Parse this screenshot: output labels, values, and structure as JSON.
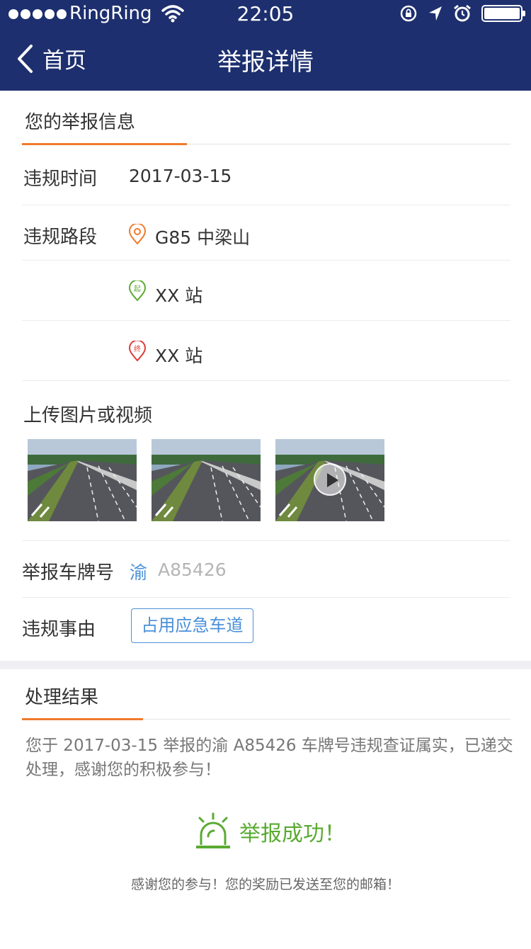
{
  "status_bar": {
    "carrier": "RingRing",
    "time": "22:05"
  },
  "nav": {
    "back_label": "首页",
    "title": "举报详情"
  },
  "report_info": {
    "section_title": "您的举报信息",
    "violation_time_label": "违规时间",
    "violation_time": "2017-03-15",
    "violation_road_label": "违规路段",
    "road": "G85 中梁山",
    "start_station": "XX 站",
    "end_station": "XX 站",
    "start_badge": "起",
    "end_badge": "终",
    "media_label": "上传图片或视频",
    "media_items": [
      "image",
      "image",
      "video"
    ],
    "plate_label": "举报车牌号",
    "plate_province": "渝",
    "plate_number": "A85426",
    "reason_label": "违规事由",
    "reason_tag": "占用应急车道"
  },
  "result": {
    "section_title": "处理结果",
    "message": "您于 2017-03-15 举报的渝 A85426 车牌号违规查证属实，已递交处理，感谢您的积极参与！",
    "success_title": "举报成功！",
    "thanks_note": "感谢您的参与！您的奖励已发送至您的邮箱！"
  },
  "colors": {
    "nav_bg": "#1d2f6e",
    "accent_orange": "#f07a2c",
    "link_blue": "#4a90d9",
    "success_green": "#5aaa32",
    "end_red": "#e03a3a"
  }
}
